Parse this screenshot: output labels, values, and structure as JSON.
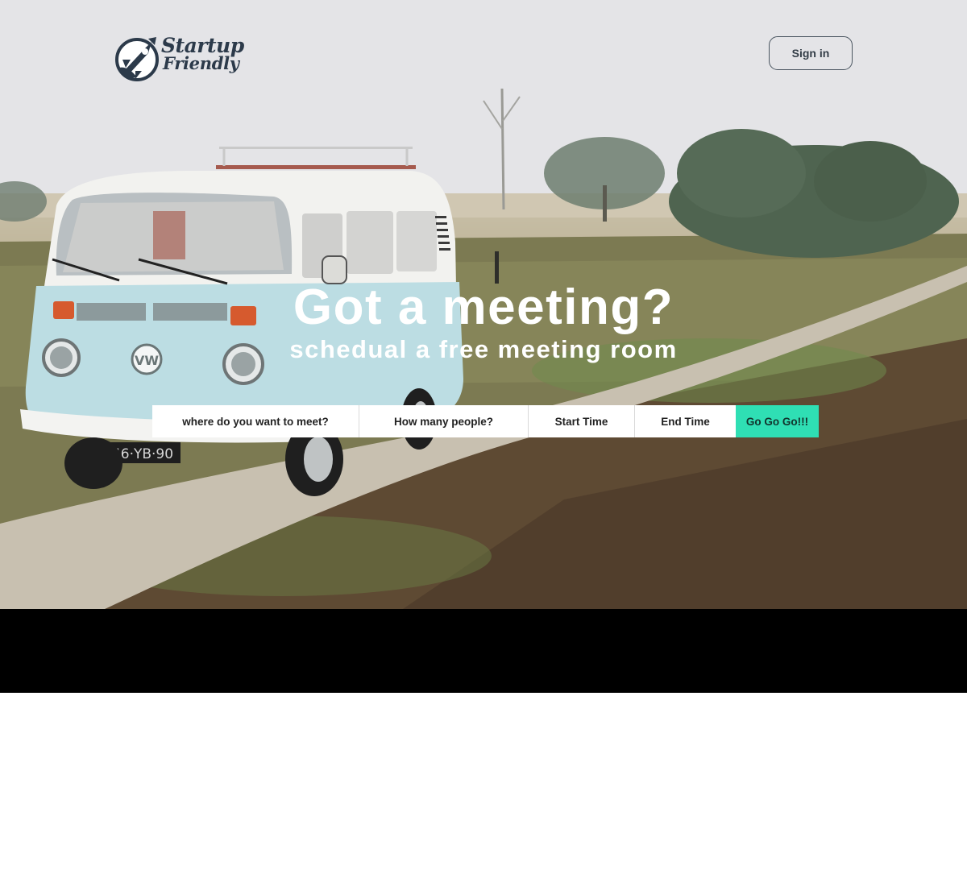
{
  "header": {
    "logo": {
      "line1": "Startup",
      "line2": "Friendly",
      "icon": "rocket-icon"
    },
    "signin_label": "Sign in"
  },
  "hero": {
    "headline": "Got a meeting?",
    "subheadline": "schedual a free meeting room",
    "background": "photo-vw-van-on-foggy-heath",
    "van_plate": "46·YB·90"
  },
  "search": {
    "where_label": "where do you want to meet?",
    "people_label": "How many people?",
    "start_label": "Start Time",
    "end_label": "End Time",
    "submit_label": "Go Go Go!!!"
  },
  "colors": {
    "accent": "#2fdfb4",
    "logo": "#2c3a4a",
    "band": "#000000",
    "text_on_hero": "#ffffff"
  }
}
